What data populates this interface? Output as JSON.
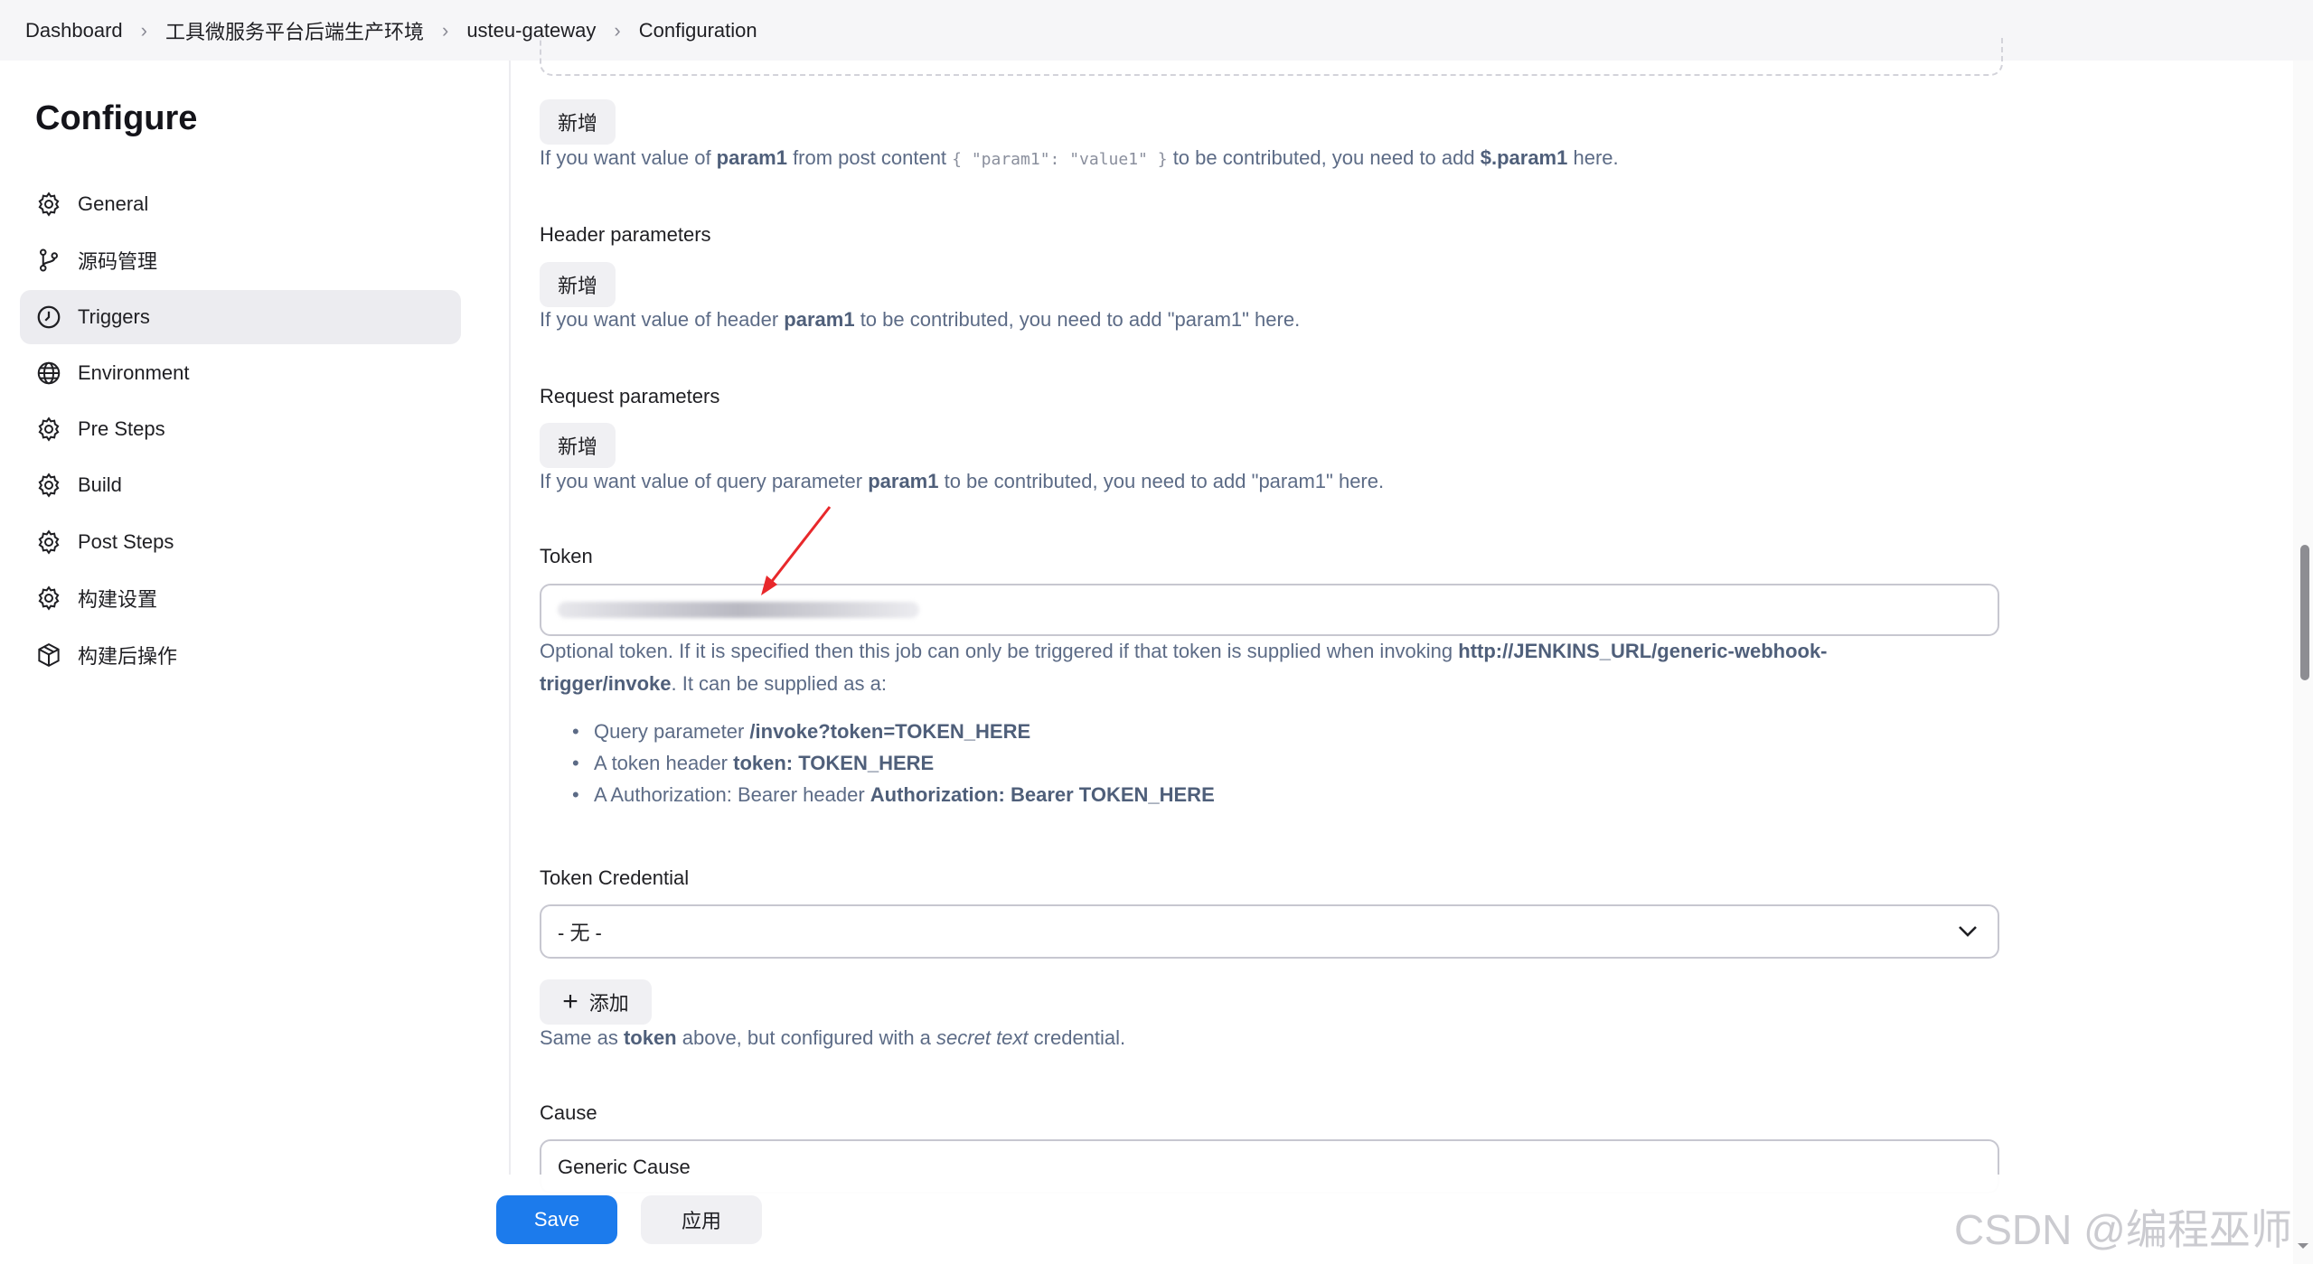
{
  "breadcrumb": [
    "Dashboard",
    "工具微服务平台后端生产环境",
    "usteu-gateway",
    "Configuration"
  ],
  "sidebar": {
    "title": "Configure",
    "items": [
      {
        "label": "General",
        "icon": "gear-icon"
      },
      {
        "label": "源码管理",
        "icon": "branch-icon"
      },
      {
        "label": "Triggers",
        "icon": "clock-icon",
        "active": true
      },
      {
        "label": "Environment",
        "icon": "globe-icon"
      },
      {
        "label": "Pre Steps",
        "icon": "gear-icon"
      },
      {
        "label": "Build",
        "icon": "gear-icon"
      },
      {
        "label": "Post Steps",
        "icon": "gear-icon"
      },
      {
        "label": "构建设置",
        "icon": "gear-icon"
      },
      {
        "label": "构建后操作",
        "icon": "cube-icon"
      }
    ]
  },
  "main": {
    "post_content": {
      "add_label": "新增",
      "help_pre": "If you want value of ",
      "help_param": "param1",
      "help_mid": " from post content ",
      "help_code": "{ \"param1\": \"value1\" }",
      "help_mid2": " to be contributed, you need to add ",
      "help_expr": "$.param1",
      "help_post": " here."
    },
    "header_params": {
      "label": "Header parameters",
      "add_label": "新增",
      "help_pre": "If you want value of header ",
      "help_param": "param1",
      "help_post": " to be contributed, you need to add \"param1\" here."
    },
    "request_params": {
      "label": "Request parameters",
      "add_label": "新增",
      "help_pre": "If you want value of query parameter ",
      "help_param": "param1",
      "help_post": " to be contributed, you need to add \"param1\" here."
    },
    "token": {
      "label": "Token",
      "help_pre": "Optional token. If it is specified then this job can only be triggered if that token is supplied when invoking ",
      "help_url_a": "http://JENKINS_URL/generic-webhook-",
      "help_url_b": "trigger/invoke",
      "help_post": ". It can be supplied as a:",
      "list": [
        {
          "pre": "Query parameter ",
          "bold": "/invoke?token=TOKEN_HERE"
        },
        {
          "pre": "A token header ",
          "bold": "token: TOKEN_HERE"
        },
        {
          "pre": "A Authorization: Bearer header ",
          "bold": "Authorization: Bearer TOKEN_HERE"
        }
      ]
    },
    "token_credential": {
      "label": "Token Credential",
      "selected": "- 无 -",
      "add_label": "添加",
      "help_pre": "Same as ",
      "help_bold": "token",
      "help_mid": " above, but configured with a ",
      "help_italic": "secret text",
      "help_post": " credential."
    },
    "cause": {
      "label": "Cause",
      "value": "Generic Cause"
    }
  },
  "footer": {
    "save_label": "Save",
    "apply_label": "应用"
  },
  "watermark": "CSDN @编程巫师",
  "colors": {
    "accent": "#1c7bec",
    "active_nav": "#ececf0",
    "help_text": "#5c6b86",
    "annotation_arrow": "#e8282b"
  }
}
